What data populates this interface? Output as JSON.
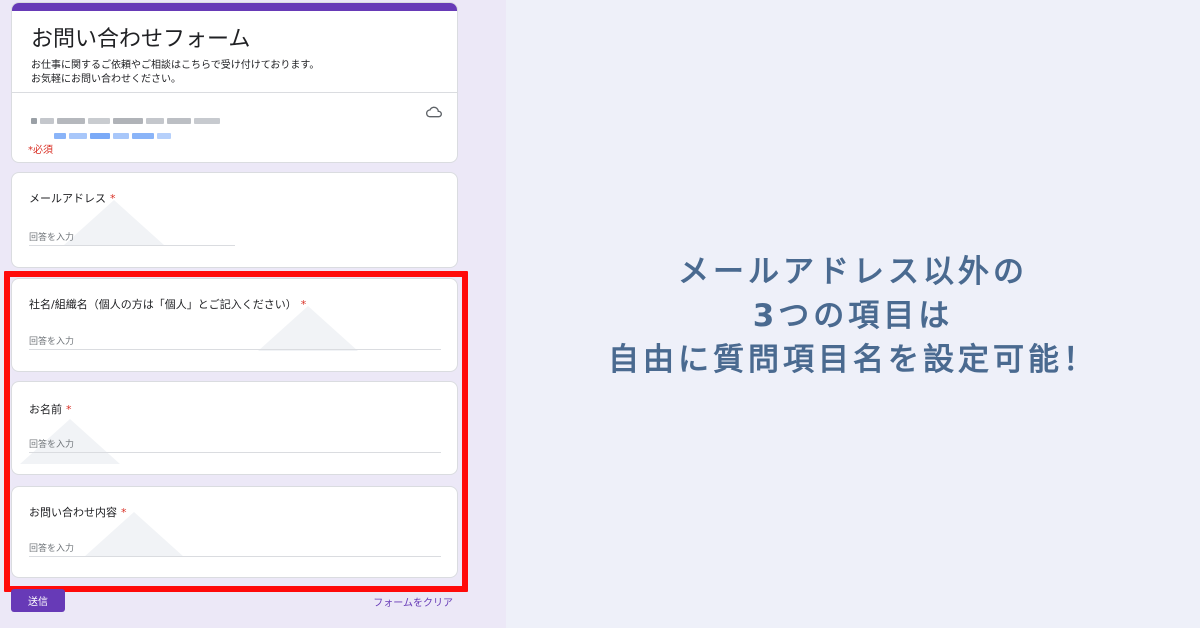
{
  "form": {
    "title": "お問い合わせフォーム",
    "description_lines": [
      "お仕事に関するご依頼やご相談はこちらで受け付けております。",
      "お気軽にお問い合わせください。"
    ],
    "required_note": "*必須",
    "accent_color": "#673ab7",
    "required_color": "#d93025",
    "questions": [
      {
        "label": "メールアドレス",
        "required_mark": "*",
        "placeholder": "回答を入力"
      },
      {
        "label": "社名/組織名（個人の方は「個人」とご記入ください）",
        "required_mark": "*",
        "placeholder": "回答を入力"
      },
      {
        "label": "お名前",
        "required_mark": "*",
        "placeholder": "回答を入力"
      },
      {
        "label": "お問い合わせ内容",
        "required_mark": "*",
        "placeholder": "回答を入力"
      }
    ],
    "submit_label": "送信",
    "clear_label": "フォームをクリア",
    "icons": {
      "save_status": "cloud-icon"
    }
  },
  "highlight_color": "#ff0a0a",
  "headline": {
    "lines": [
      "メールアドレス以外の",
      "3つの項目は",
      "自由に質問項目名を設定可能！"
    ],
    "color": "#4a6a90"
  }
}
